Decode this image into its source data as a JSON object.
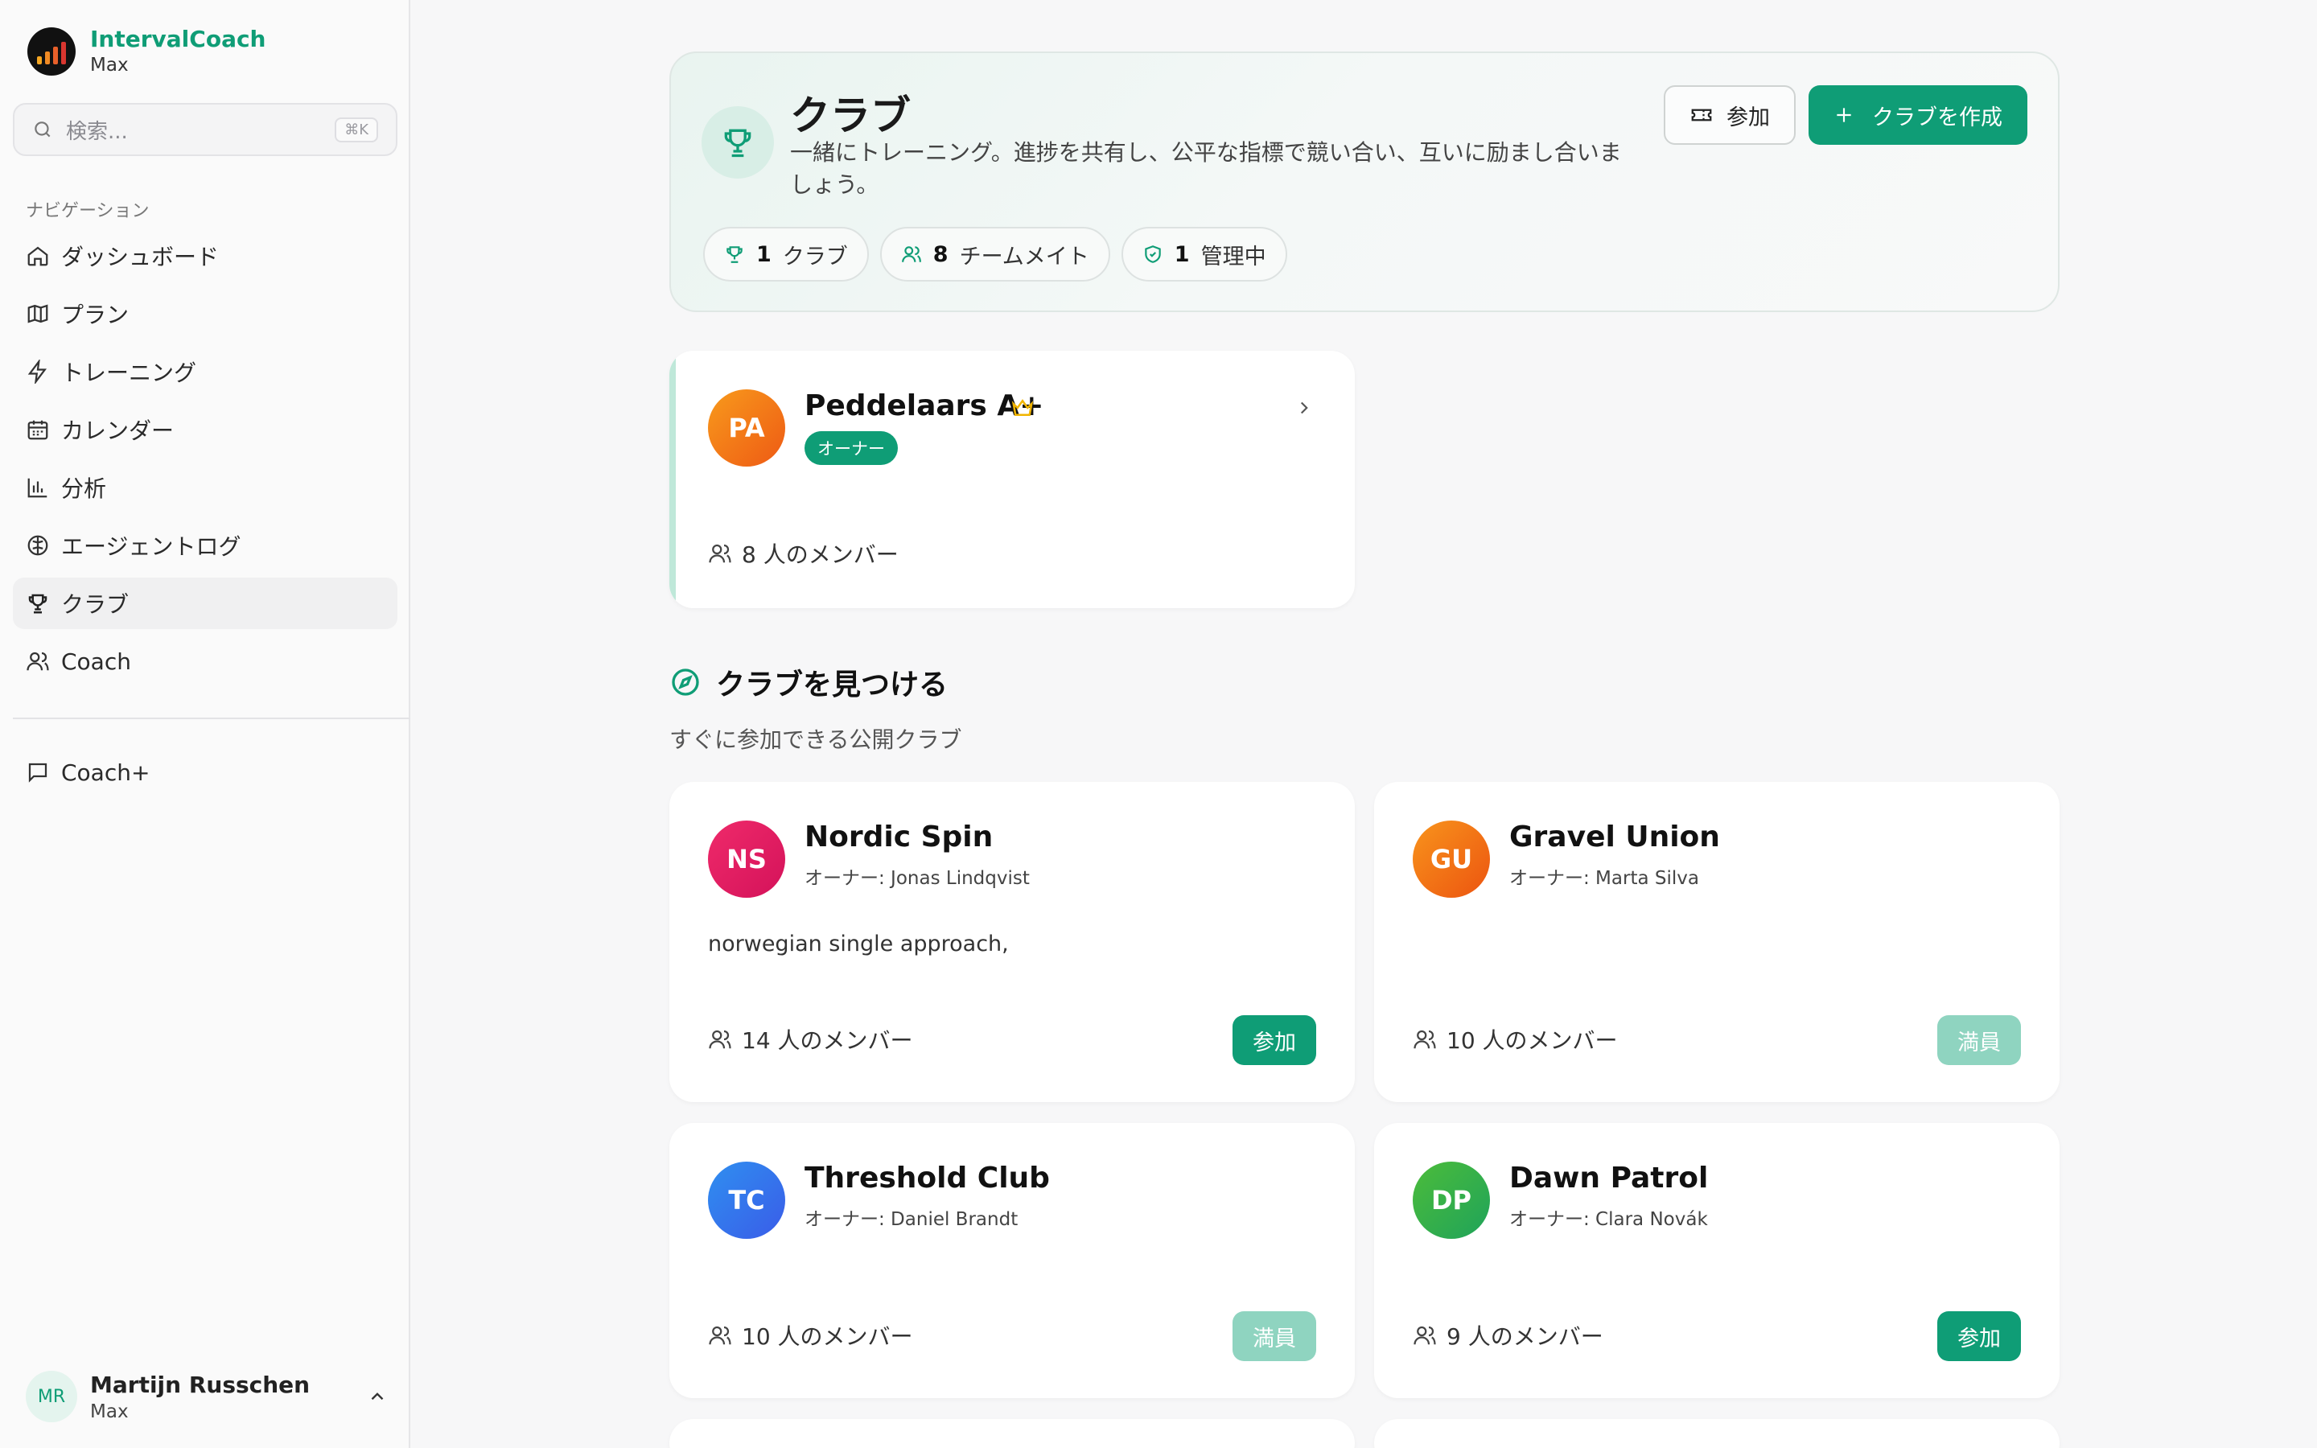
{
  "app": {
    "name": "IntervalCoach",
    "plan": "Max"
  },
  "search": {
    "placeholder": "検索...",
    "shortcut": "⌘K"
  },
  "nav": {
    "title": "ナビゲーション",
    "items": [
      {
        "label": "ダッシュボード",
        "icon": "home-icon"
      },
      {
        "label": "プラン",
        "icon": "map-icon"
      },
      {
        "label": "トレーニング",
        "icon": "zap-icon"
      },
      {
        "label": "カレンダー",
        "icon": "calendar-icon"
      },
      {
        "label": "分析",
        "icon": "bar-chart-icon"
      },
      {
        "label": "エージェントログ",
        "icon": "brain-icon"
      },
      {
        "label": "クラブ",
        "icon": "trophy-icon",
        "active": true
      },
      {
        "label": "Coach",
        "icon": "users-icon"
      }
    ],
    "coachplus": "Coach+"
  },
  "user": {
    "initials": "MR",
    "name": "Martijn Russchen",
    "plan": "Max"
  },
  "header": {
    "title": "クラブ",
    "description": "一緒にトレーニング。進捗を共有し、公平な指標で競い合い、互いに励まし合いましょう。",
    "join_label": "参加",
    "create_label": "クラブを作成",
    "stats": [
      {
        "value": "1",
        "label": "クラブ",
        "icon": "trophy-icon"
      },
      {
        "value": "8",
        "label": "チームメイト",
        "icon": "users-icon"
      },
      {
        "value": "1",
        "label": "管理中",
        "icon": "shield-icon"
      }
    ]
  },
  "my_club": {
    "initials": "PA",
    "name": "Peddelaars A+",
    "badge": "オーナー",
    "members": "8 人のメンバー"
  },
  "discover": {
    "title": "クラブを見つける",
    "subtitle": "すぐに参加できる公開クラブ",
    "clubs": [
      {
        "initials": "NS",
        "name": "Nordic Spin",
        "owner": "オーナー: Jonas Lindqvist",
        "description": "norwegian single approach,",
        "members": "14 人のメンバー",
        "action": "参加",
        "full": false,
        "color": "#e6195f"
      },
      {
        "initials": "GU",
        "name": "Gravel Union",
        "owner": "オーナー: Marta Silva",
        "description": "",
        "members": "10 人のメンバー",
        "action": "満員",
        "full": true,
        "color": "#f16a10"
      },
      {
        "initials": "TC",
        "name": "Threshold Club",
        "owner": "オーナー: Daniel Brandt",
        "description": "",
        "members": "10 人のメンバー",
        "action": "満員",
        "full": true,
        "color": "#2f6ff0"
      },
      {
        "initials": "DP",
        "name": "Dawn Patrol",
        "owner": "オーナー: Clara Novák",
        "description": "",
        "members": "9 人のメンバー",
        "action": "参加",
        "full": false,
        "color": "#2fae43"
      }
    ]
  },
  "colors": {
    "accent": "#0f9d76",
    "accent_muted": "#8fd4c0",
    "crown": "#f0b400"
  }
}
